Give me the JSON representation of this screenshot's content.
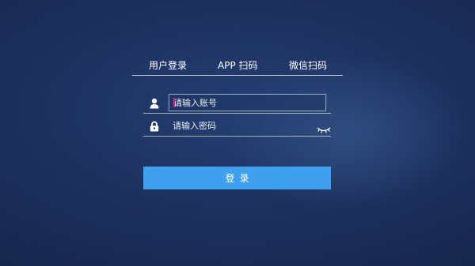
{
  "tabs": [
    {
      "label": "用户登录"
    },
    {
      "label": "APP 扫码"
    },
    {
      "label": "微信扫码"
    }
  ],
  "form": {
    "username": {
      "placeholder": "请输入账号",
      "value": "",
      "icon": "user-icon"
    },
    "password": {
      "placeholder": "请输入密码",
      "value": "",
      "icon": "lock-icon",
      "toggle_icon": "eye-closed-icon"
    }
  },
  "login_button": {
    "label": "登录"
  },
  "colors": {
    "background": "#1c2f5c",
    "button": "#3fa0ef",
    "caret": "#e0208a",
    "underline": "#d2e1b4"
  }
}
